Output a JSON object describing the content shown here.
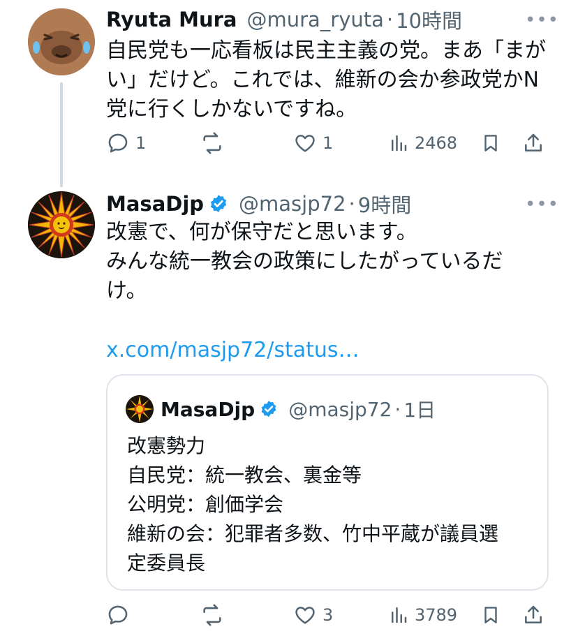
{
  "tweet1": {
    "name": "Ryuta Mura",
    "handle": "@mura_ryuta",
    "separator": "·",
    "time": "10時間",
    "more": "•••",
    "lines": [
      "自民党も一応看板は民主主義の党。まあ「まが",
      "い」だけど。これでは、維新の会か参政党かN",
      "党に行くしかないですね。"
    ],
    "replies": "1",
    "reposts": "",
    "likes": "1",
    "views": "2468"
  },
  "tweet2": {
    "name": "MasaDjp",
    "handle": "@masjp72",
    "separator": "·",
    "time": "9時間",
    "more": "•••",
    "lines": [
      "改憲で、何が保守だと思います。",
      "みんな統一教会の政策にしたがっているだ",
      "け。"
    ],
    "link": "x.com/masjp72/status…",
    "replies": "",
    "reposts": "",
    "likes": "3",
    "views": "3789"
  },
  "quote": {
    "name": "MasaDjp",
    "handle": "@masjp72",
    "separator": "·",
    "time": "1日",
    "lines": [
      "改憲勢力",
      "自民党：統一教会、裏金等",
      "公明党：創価学会",
      "維新の会：犯罪者多数、竹中平蔵が議員選",
      "定委員長"
    ]
  },
  "colors": {
    "verified": "#1d9bf0",
    "link": "#1d9bf0",
    "muted": "#536471"
  }
}
